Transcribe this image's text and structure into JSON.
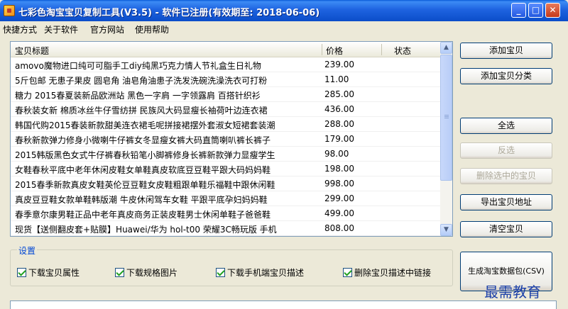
{
  "window": {
    "title": "七彩色淘宝宝贝复制工具(V3.5) - 软件已注册(有效期至: 2018-06-06)",
    "minimize_glyph": "_",
    "maximize_glyph": "□",
    "close_glyph": "✕"
  },
  "menu": [
    "快捷方式",
    "关于软件",
    "官方网站",
    "使用帮助"
  ],
  "table": {
    "columns": [
      "宝贝标题",
      "价格",
      "状态"
    ],
    "rows": [
      {
        "title": "amovo魔物进口纯可可脂手工diy纯黑巧克力情人节礼盒生日礼物",
        "price": "239.00",
        "status": ""
      },
      {
        "title": "5斤包邮 无患子果皮 圆皂角 油皂角油患子洗发洗碗洗澡洗衣可打粉",
        "price": "11.00",
        "status": ""
      },
      {
        "title": "糖力 2015春夏装新品欧洲站 黑色一字肩 一字领露肩 百搭针织衫",
        "price": "285.00",
        "status": ""
      },
      {
        "title": "春秋装女新 棉质冰丝牛仔雪纺拼 民族风大码显瘦长袖荷叶边连衣裙",
        "price": "436.00",
        "status": ""
      },
      {
        "title": "韩国代购2015春装新款甜美连衣裙毛呢拼接裙摆外套淑女短裙套装潮",
        "price": "288.00",
        "status": ""
      },
      {
        "title": "春秋新款弹力修身小微喇牛仔裤女冬显瘦女裤大码直筒喇叭裤长裤子",
        "price": "179.00",
        "status": ""
      },
      {
        "title": "2015韩版黑色女式牛仔裤春秋铅笔小脚裤修身长裤新款弹力显瘦学生",
        "price": "98.00",
        "status": ""
      },
      {
        "title": "女鞋春秋平底中老年休闲皮鞋女单鞋真皮软底豆豆鞋平跟大码妈妈鞋",
        "price": "198.00",
        "status": ""
      },
      {
        "title": "2015春季新款真皮女鞋英伦豆豆鞋女皮鞋粗跟单鞋乐福鞋中跟休闲鞋",
        "price": "998.00",
        "status": ""
      },
      {
        "title": "真皮豆豆鞋女款单鞋韩版潮 牛皮休闲驾车女鞋 平跟平底孕妇妈妈鞋",
        "price": "299.00",
        "status": ""
      },
      {
        "title": "春季意尔康男鞋正品中老年真皮商务正装皮鞋男士休闲单鞋子爸爸鞋",
        "price": "499.00",
        "status": ""
      },
      {
        "title": "现货【送侧翻皮套+贴膜】Huawei/华为 hol-t00 荣耀3C畅玩版 手机",
        "price": "808.00",
        "status": ""
      }
    ]
  },
  "buttons": {
    "add_item": "添加宝贝",
    "add_category": "添加宝贝分类",
    "select_all": "全选",
    "invert_selection": "反选",
    "delete_selected": "删除选中的宝贝",
    "export_urls": "导出宝贝地址",
    "clear_items": "清空宝贝",
    "generate_csv": "生成淘宝数据包(CSV)"
  },
  "settings": {
    "label": "设置",
    "options": [
      {
        "label": "下载宝贝属性",
        "checked": true
      },
      {
        "label": "下载规格图片",
        "checked": true
      },
      {
        "label": "下载手机端宝贝描述",
        "checked": true
      },
      {
        "label": "删除宝贝描述中链接",
        "checked": true
      }
    ]
  },
  "scroll": {
    "up_glyph": "▲",
    "down_glyph": "▼"
  },
  "watermark": "最需教育"
}
